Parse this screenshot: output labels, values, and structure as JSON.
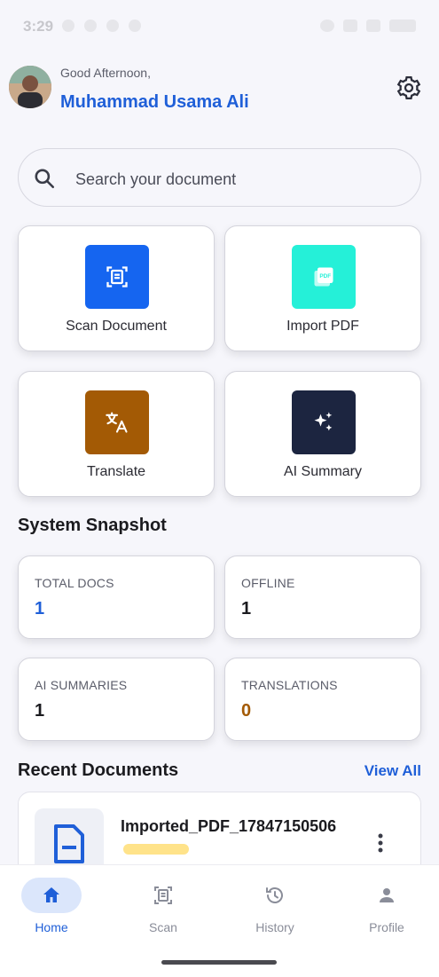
{
  "status_bar": {
    "time": "3:29"
  },
  "header": {
    "greeting": "Good Afternoon,",
    "user_name": "Muhammad Usama Ali",
    "settings_icon": "gear-icon"
  },
  "search": {
    "placeholder": "Search your document",
    "icon": "search-icon"
  },
  "actions": [
    {
      "label": "Scan Document",
      "icon": "scan-document-icon",
      "color": "#1565f0"
    },
    {
      "label": "Import PDF",
      "icon": "pdf-icon",
      "color": "#25f0d8"
    },
    {
      "label": "Translate",
      "icon": "translate-icon",
      "color": "#a35a05"
    },
    {
      "label": "AI Summary",
      "icon": "sparkles-icon",
      "color": "#1c2540"
    }
  ],
  "snapshot": {
    "title": "System Snapshot",
    "stats": [
      {
        "label": "TOTAL DOCS",
        "value": "1",
        "color": "#1f5fd8"
      },
      {
        "label": "OFFLINE",
        "value": "1",
        "color": "#1b1b1f"
      },
      {
        "label": "AI SUMMARIES",
        "value": "1",
        "color": "#1b1b1f"
      },
      {
        "label": "TRANSLATIONS",
        "value": "0",
        "color": "#a35a05"
      }
    ]
  },
  "recent": {
    "title": "Recent Documents",
    "view_all": "View All",
    "documents": [
      {
        "name": "Imported_PDF_17847150506"
      }
    ]
  },
  "bottom_nav": {
    "items": [
      {
        "label": "Home",
        "icon": "home-icon",
        "active": true
      },
      {
        "label": "Scan",
        "icon": "scan-icon",
        "active": false
      },
      {
        "label": "History",
        "icon": "history-icon",
        "active": false
      },
      {
        "label": "Profile",
        "icon": "profile-icon",
        "active": false
      }
    ],
    "active_color": "#1f5fd8",
    "inactive_color": "#8a8d99"
  }
}
